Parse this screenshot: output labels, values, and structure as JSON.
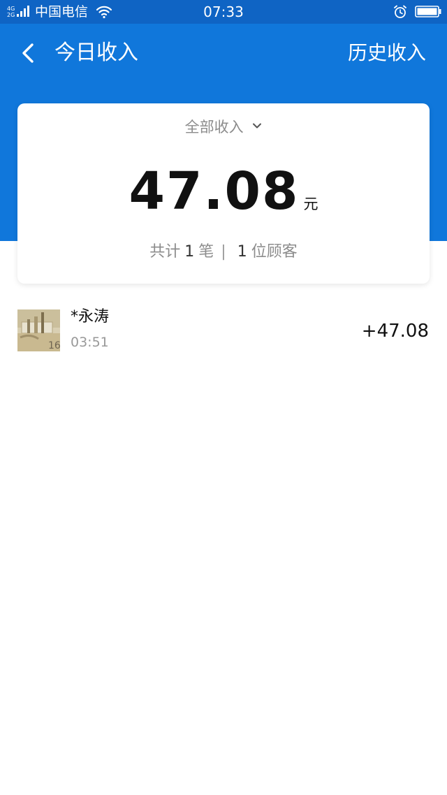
{
  "status_bar": {
    "network_gen_1": "4G",
    "network_gen_2": "2G",
    "carrier": "中国电信",
    "time": "07:33",
    "icons": [
      "signal-icon",
      "wifi-icon",
      "alarm-icon",
      "battery-icon"
    ]
  },
  "header": {
    "back_icon": "chevron-left-icon",
    "title": "今日收入",
    "history_label": "历史收入"
  },
  "summary": {
    "filter_label": "全部收入",
    "filter_icon": "chevron-down-icon",
    "amount": "47.08",
    "unit": "元",
    "count_prefix": "共计",
    "count_value": "1",
    "count_suffix": "笔",
    "separator": "|",
    "customers_value": "1",
    "customers_suffix": "位顾客"
  },
  "transactions": [
    {
      "name": "*永涛",
      "time": "03:51",
      "amount": "+47.08",
      "thumb_text": "16"
    }
  ],
  "colors": {
    "status_bar": "#0f64c4",
    "header": "#1077db",
    "secondary_text": "#8c8c8c",
    "primary_text": "#111111"
  }
}
